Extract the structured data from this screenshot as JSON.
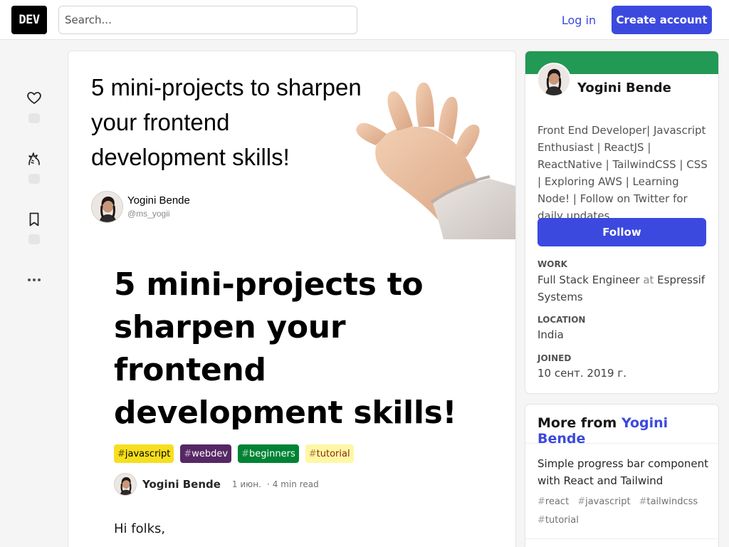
{
  "header": {
    "logo_text": "DEV",
    "search_placeholder": "Search...",
    "login_label": "Log in",
    "create_account_label": "Create account"
  },
  "reactions": {
    "like_icon": "heart-icon",
    "unicorn_icon": "unicorn-icon",
    "bookmark_icon": "bookmark-icon",
    "more_icon": "more-horizontal-icon"
  },
  "article": {
    "cover": {
      "title": "5 mini-projects to sharpen your frontend development skills!",
      "author_name": "Yogini Bende",
      "author_handle": "@ms_yogii",
      "image": "waving-hand-illustration"
    },
    "title": "5 mini-projects to sharpen your frontend development skills!",
    "tags": [
      {
        "hash": "#",
        "name": "javascript",
        "bg": "#f7df1e",
        "fg": "#000000"
      },
      {
        "hash": "#",
        "name": "webdev",
        "bg": "#562765",
        "fg": "#ffffff"
      },
      {
        "hash": "#",
        "name": "beginners",
        "bg": "#008335",
        "fg": "#ffffff"
      },
      {
        "hash": "#",
        "name": "tutorial",
        "bg": "#fef7a6",
        "fg": "#8a2b06"
      }
    ],
    "byline": {
      "author": "Yogini Bende",
      "date": "1 июн.",
      "dot": "·",
      "read_time": "4 min read"
    },
    "body_first_line": "Hi folks,"
  },
  "profile": {
    "name": "Yogini Bende",
    "bio": "Front End Developer| Javascript Enthusiast | ReactJS | ReactNative | TailwindCSS | CSS | Exploring AWS | Learning Node! | Follow on Twitter for daily updates",
    "follow_label": "Follow",
    "brand_color": "#229954",
    "work_label": "WORK",
    "work_role": "Full Stack Engineer",
    "work_at": "at",
    "work_company": "Espressif Systems",
    "location_label": "LOCATION",
    "location_value": "India",
    "joined_label": "JOINED",
    "joined_value": "10 сент. 2019 г."
  },
  "more_from": {
    "prefix": "More from",
    "author": "Yogini Bende",
    "items": [
      {
        "title": "Simple progress bar component with React and Tailwind",
        "tags": [
          "react",
          "javascript",
          "tailwindcss",
          "tutorial"
        ]
      }
    ]
  }
}
